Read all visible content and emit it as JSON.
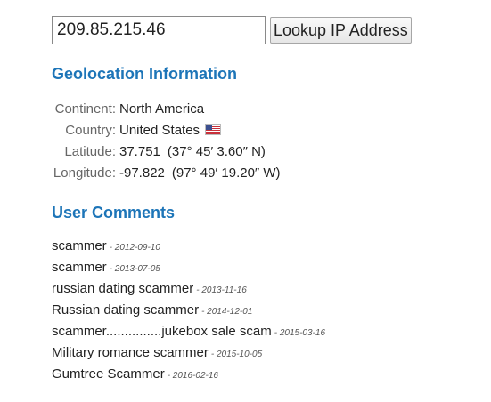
{
  "lookup": {
    "ip_value": "209.85.215.46",
    "button_label": "Lookup IP Address"
  },
  "geolocation": {
    "title": "Geolocation Information",
    "rows": [
      {
        "label": "Continent:",
        "value": "North America"
      },
      {
        "label": "Country:",
        "value": "United States",
        "flag": "us-flag-icon"
      },
      {
        "label": "Latitude:",
        "value": "37.751",
        "dms": "(37° 45′ 3.60″ N)"
      },
      {
        "label": "Longitude:",
        "value": "-97.822",
        "dms": "(97° 49′ 19.20″ W)"
      }
    ]
  },
  "comments": {
    "title": "User Comments",
    "items": [
      {
        "text": "scammer",
        "date": "- 2012-09-10"
      },
      {
        "text": "scammer",
        "date": "- 2013-07-05"
      },
      {
        "text": "russian dating scammer",
        "date": "- 2013-11-16"
      },
      {
        "text": "Russian dating scammer",
        "date": "- 2014-12-01"
      },
      {
        "text": "scammer...............jukebox sale scam",
        "date": "- 2015-03-16"
      },
      {
        "text": "Military romance scammer",
        "date": "- 2015-10-05"
      },
      {
        "text": "Gumtree Scammer",
        "date": "- 2016-02-16"
      }
    ]
  },
  "colors": {
    "heading": "#1d75b8",
    "label": "#666666",
    "text": "#222222"
  }
}
